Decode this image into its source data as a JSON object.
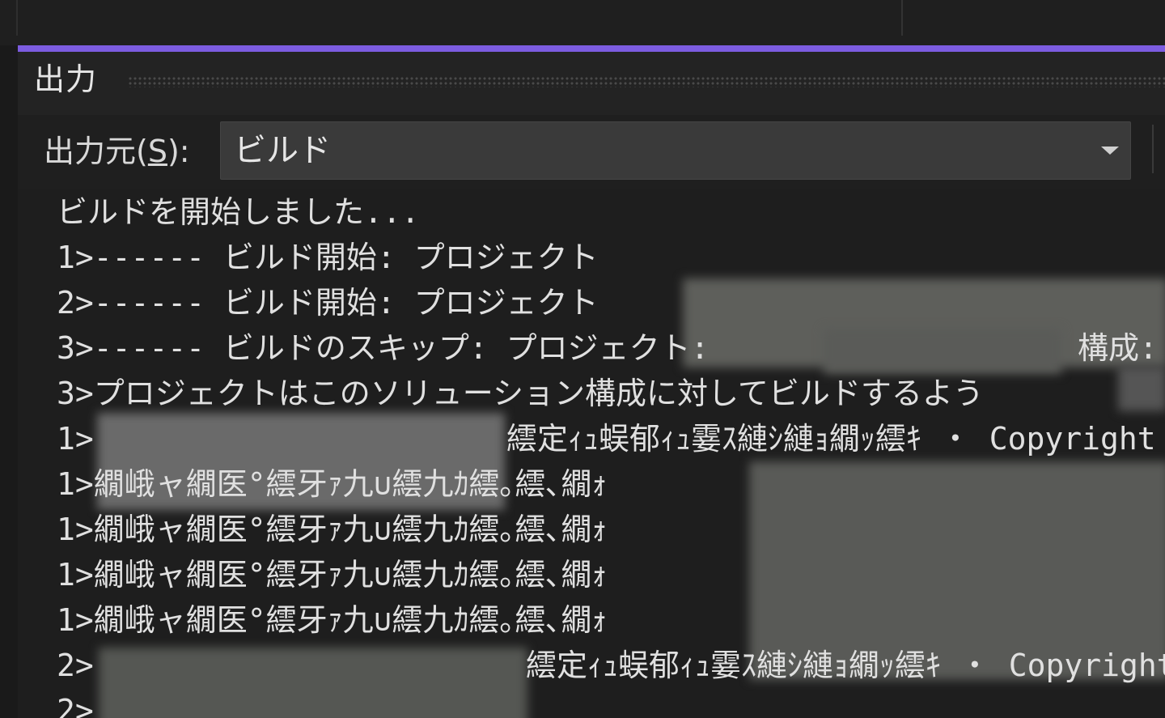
{
  "panel": {
    "title": "出力",
    "source_label_prefix": "出力元(",
    "source_label_mnemonic": "S",
    "source_label_suffix": "):",
    "source_value": "ビルド"
  },
  "output_lines": [
    "ビルドを開始しました...",
    "1>------ ビルド開始: プロジェクト",
    "2>------ ビルド開始: プロジェクト",
    "3>------ ビルドのスキップ: プロジェクト:",
    "3>プロジェクトはこのソリューション構成に対してビルドするよう",
    "1>",
    "1>繝峨ャ繝医°繧牙ｧ九∪繧九ｶ繧｡繧､繝ｫ",
    "1>繝峨ャ繝医°繧牙ｧ九∪繧九ｶ繧｡繧､繝ｫ",
    "1>繝峨ャ繝医°繧牙ｧ九∪繧九ｶ繧｡繧､繝ｫ",
    "1>繝峨ャ繝医°繧牙ｧ九∪繧九ｶ繧｡繧､繝ｫ",
    "2>",
    "2>"
  ],
  "line_fragments": {
    "line3_config": "構成:",
    "line5_tail": "繧定ｨｭ蜈郁ｨｭ霎ｽ縺ｼ縺ｮ繝ｯ繧ｷ ・ Copyright",
    "line10_tail": "繧定ｨｭ蜈郁ｨｭ霎ｽ縺ｼ縺ｮ繝ｯ繧ｷ ・ Copyright"
  },
  "colors": {
    "accent": "#7c5ce0",
    "background": "#1e1e1e",
    "text": "#e0e0e0"
  }
}
